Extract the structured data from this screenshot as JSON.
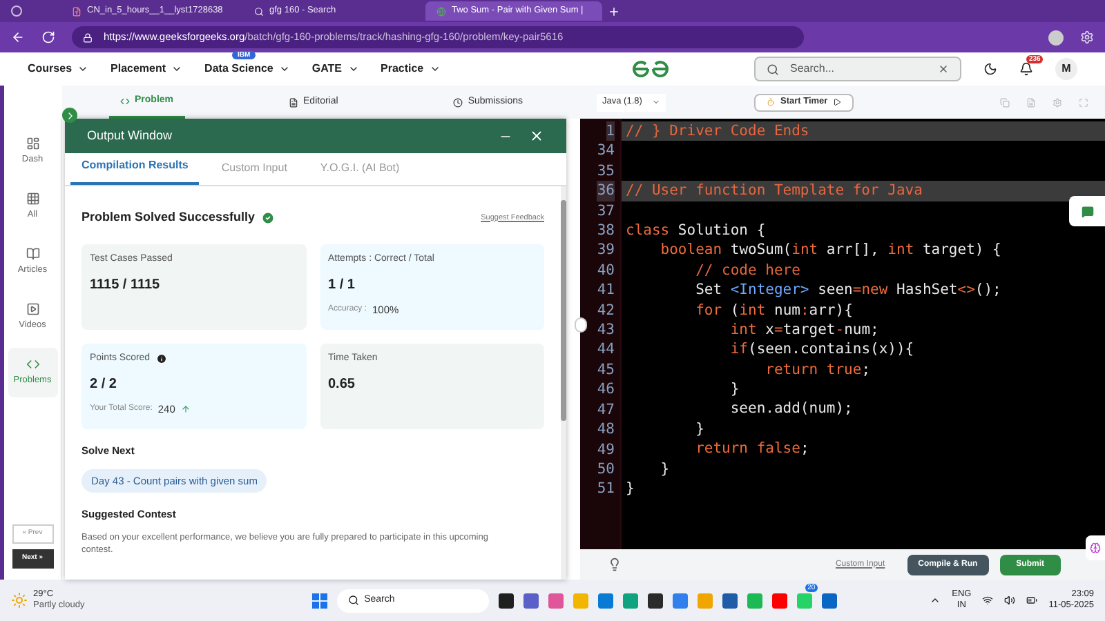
{
  "browser": {
    "tabs": [
      {
        "title": "CN_in_5_hours__1__lyst1728638",
        "selected": false,
        "kind": "pdf"
      },
      {
        "title": "gfg 160 - Search",
        "selected": false,
        "kind": "search"
      },
      {
        "title": "Two Sum - Pair with Given Sum |",
        "selected": true,
        "kind": "site"
      }
    ],
    "url_host": "https://www.geeksforgeeks.org",
    "url_path": "/batch/gfg-160-problems/track/hashing-gfg-160/problem/key-pair5616"
  },
  "site_nav": {
    "items": [
      {
        "label": "Courses"
      },
      {
        "label": "Placement"
      },
      {
        "label": "Data Science",
        "badge": "IBM"
      },
      {
        "label": "GATE"
      },
      {
        "label": "Practice"
      }
    ],
    "search": {
      "placeholder": "Search..."
    },
    "notifications": "236",
    "avatar": "M"
  },
  "problem_tabs": [
    {
      "label": "Problem",
      "selected": true
    },
    {
      "label": "Editorial",
      "selected": false
    },
    {
      "label": "Submissions",
      "selected": false
    }
  ],
  "sidebar": {
    "items": [
      {
        "label": "Dash",
        "selected": false
      },
      {
        "label": "All",
        "selected": false
      },
      {
        "label": "Articles",
        "selected": false
      },
      {
        "label": "Videos",
        "selected": false
      },
      {
        "label": "Problems",
        "selected": true
      }
    ],
    "prev": "« Prev",
    "next": "Next »"
  },
  "output_window": {
    "title": "Output Window",
    "tabs": [
      {
        "label": "Compilation Results",
        "selected": true
      },
      {
        "label": "Custom Input",
        "selected": false
      },
      {
        "label": "Y.O.G.I. (AI Bot)",
        "selected": false
      }
    ],
    "status": "Problem Solved Successfully",
    "feedback": "Suggest Feedback",
    "stats": [
      {
        "label": "Test Cases Passed",
        "value": "1115 / 1115",
        "kind": "plain"
      },
      {
        "label": "Attempts : Correct / Total",
        "value": "1 / 1",
        "sub_label": "Accuracy :",
        "sub_value": "100%",
        "kind": "accent"
      },
      {
        "label": "Points Scored",
        "value": "2 / 2",
        "sub_label": "Your Total Score:",
        "sub_value": "240",
        "info": true,
        "trend_up": true,
        "kind": "accent"
      },
      {
        "label": "Time Taken",
        "value": "0.65",
        "kind": "plain"
      }
    ],
    "solve_next_heading": "Solve Next",
    "solve_next": "Day 43 - Count pairs with given sum",
    "contest_heading": "Suggested Contest",
    "contest_text": "Based on your excellent performance, we believe you are fully prepared to participate in this upcoming contest."
  },
  "editor": {
    "language": "Java (1.8)",
    "timer": "Start Timer",
    "lines": [
      {
        "n": "1",
        "highlighted": true,
        "tokens": [
          {
            "kind": "comment",
            "text": "// } Driver Code Ends"
          }
        ]
      },
      {
        "n": "34",
        "highlighted": false
      },
      {
        "n": "35",
        "highlighted": false
      },
      {
        "n": "36",
        "highlighted": true,
        "tokens": [
          {
            "kind": "comment",
            "text": "// User function Template for Java"
          }
        ]
      },
      {
        "n": "37",
        "highlighted": false
      },
      {
        "n": "38",
        "highlighted": false,
        "tokens": [
          {
            "kind": "keyword",
            "text": "class"
          },
          {
            "kind": "plain",
            "text": " Solution {"
          }
        ]
      },
      {
        "n": "39",
        "highlighted": false,
        "tokens": [
          {
            "kind": "keyword",
            "text": "    boolean"
          },
          {
            "kind": "plain",
            "text": " twoSum("
          },
          {
            "kind": "keyword",
            "text": "int"
          },
          {
            "kind": "plain",
            "text": " arr[], "
          },
          {
            "kind": "keyword",
            "text": "int"
          },
          {
            "kind": "plain",
            "text": " target) {"
          }
        ]
      },
      {
        "n": "40",
        "highlighted": false,
        "tokens": [
          {
            "kind": "comment",
            "text": "        // code here"
          }
        ]
      },
      {
        "n": "41",
        "highlighted": false,
        "tokens": [
          {
            "kind": "plain",
            "text": "        Set "
          },
          {
            "kind": "type",
            "text": "<Integer>"
          },
          {
            "kind": "plain",
            "text": " seen"
          },
          {
            "kind": "keyword",
            "text": "="
          },
          {
            "kind": "keyword",
            "text": "new"
          },
          {
            "kind": "plain",
            "text": " HashSet"
          },
          {
            "kind": "keyword",
            "text": "<>"
          },
          {
            "kind": "plain",
            "text": "();"
          }
        ]
      },
      {
        "n": "42",
        "highlighted": false,
        "tokens": [
          {
            "kind": "keyword",
            "text": "        for"
          },
          {
            "kind": "plain",
            "text": " ("
          },
          {
            "kind": "keyword",
            "text": "int"
          },
          {
            "kind": "plain",
            "text": " num"
          },
          {
            "kind": "keyword",
            "text": ":"
          },
          {
            "kind": "plain",
            "text": "arr){"
          }
        ]
      },
      {
        "n": "43",
        "highlighted": false,
        "tokens": [
          {
            "kind": "keyword",
            "text": "            int"
          },
          {
            "kind": "plain",
            "text": " x"
          },
          {
            "kind": "keyword",
            "text": "="
          },
          {
            "kind": "plain",
            "text": "target"
          },
          {
            "kind": "keyword",
            "text": "-"
          },
          {
            "kind": "plain",
            "text": "num;"
          }
        ]
      },
      {
        "n": "44",
        "highlighted": false,
        "tokens": [
          {
            "kind": "keyword",
            "text": "            if"
          },
          {
            "kind": "plain",
            "text": "(seen.contains(x)){"
          }
        ]
      },
      {
        "n": "45",
        "highlighted": false,
        "tokens": [
          {
            "kind": "keyword",
            "text": "                return"
          },
          {
            "kind": "keyword",
            "text": " true"
          },
          {
            "kind": "plain",
            "text": ";"
          }
        ]
      },
      {
        "n": "46",
        "highlighted": false,
        "tokens": [
          {
            "kind": "plain",
            "text": "            }"
          }
        ]
      },
      {
        "n": "47",
        "highlighted": false,
        "tokens": [
          {
            "kind": "plain",
            "text": "            seen.add(num);"
          }
        ]
      },
      {
        "n": "48",
        "highlighted": false,
        "tokens": [
          {
            "kind": "plain",
            "text": "        }"
          }
        ]
      },
      {
        "n": "49",
        "highlighted": false,
        "tokens": [
          {
            "kind": "keyword",
            "text": "        return"
          },
          {
            "kind": "keyword",
            "text": " false"
          },
          {
            "kind": "plain",
            "text": ";"
          }
        ]
      },
      {
        "n": "50",
        "highlighted": false,
        "tokens": [
          {
            "kind": "plain",
            "text": "    }"
          }
        ]
      },
      {
        "n": "51",
        "highlighted": false,
        "tokens": [
          {
            "kind": "plain",
            "text": "}"
          }
        ]
      }
    ],
    "custom_input": "Custom Input",
    "compile": "Compile & Run",
    "submit": "Submit"
  },
  "taskbar": {
    "temp": "29°C",
    "weather": "Partly cloudy",
    "search_placeholder": "Search",
    "apps": [
      {
        "color": "#1f1f1f"
      },
      {
        "color": "#5b5fc7"
      },
      {
        "color": "#e0569a"
      },
      {
        "color": "#f2b600"
      },
      {
        "color": "#0a7bd4"
      },
      {
        "color": "#10a37f"
      },
      {
        "color": "#2b2b2b"
      },
      {
        "color": "#2f80ed"
      },
      {
        "color": "#f0a500"
      },
      {
        "color": "#1f5ca8"
      },
      {
        "color": "#1db954"
      },
      {
        "color": "#ff0000"
      },
      {
        "color": "#25d366",
        "badge": "20"
      },
      {
        "color": "#0a66c2"
      }
    ],
    "lang": "ENG",
    "region": "IN",
    "time": "23:09",
    "date": "11-05-2025"
  }
}
